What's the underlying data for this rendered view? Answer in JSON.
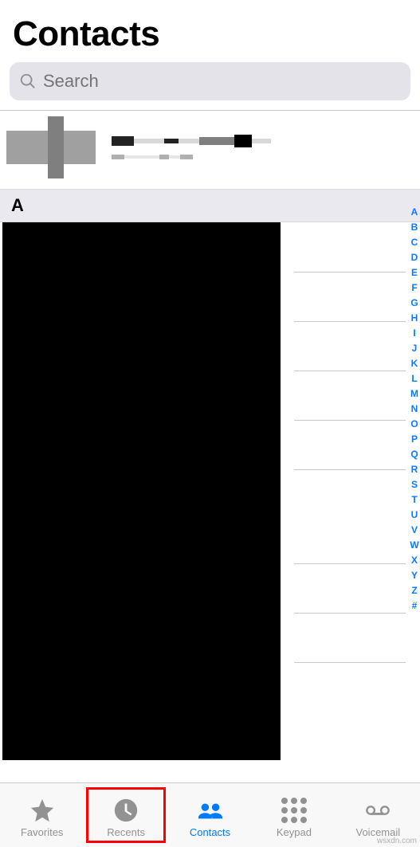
{
  "header": {
    "title": "Contacts"
  },
  "search": {
    "placeholder": "Search"
  },
  "sections": {
    "first": "A"
  },
  "index_letters": [
    "A",
    "B",
    "C",
    "D",
    "E",
    "F",
    "G",
    "H",
    "I",
    "J",
    "K",
    "L",
    "M",
    "N",
    "O",
    "P",
    "Q",
    "R",
    "S",
    "T",
    "U",
    "V",
    "W",
    "X",
    "Y",
    "Z",
    "#"
  ],
  "tabbar": {
    "favorites": "Favorites",
    "recents": "Recents",
    "contacts": "Contacts",
    "keypad": "Keypad",
    "voicemail": "Voicemail",
    "active": "contacts",
    "highlighted": "recents"
  },
  "colors": {
    "accent": "#007aff",
    "highlight_box": "#ff0000"
  },
  "watermark": "wsxdn.com"
}
